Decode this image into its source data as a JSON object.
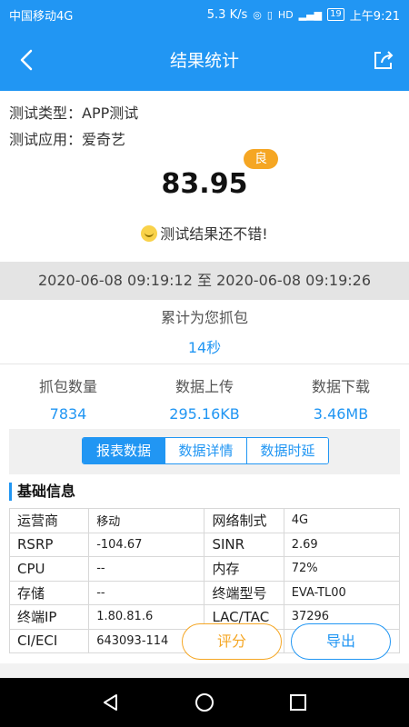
{
  "status_bar": {
    "carrier": "中国移动4G",
    "speed": "5.3 K/s",
    "battery": "19",
    "time": "上午9:21"
  },
  "header": {
    "title": "结果统计",
    "back_icon": "back-arrow-icon",
    "share_icon": "share-icon"
  },
  "info": {
    "type_label": "测试类型：APP测试",
    "app_label": "测试应用：爱奇艺"
  },
  "score": {
    "value": "83.95",
    "grade": "良",
    "remark": "测试结果还不错!"
  },
  "time_range": "2020-06-08 09:19:12  至  2020-06-08 09:19:26",
  "cumulative": {
    "label": "累计为您抓包",
    "value": "14秒"
  },
  "stats": [
    {
      "label": "抓包数量",
      "value": "7834"
    },
    {
      "label": "数据上传",
      "value": "295.16KB"
    },
    {
      "label": "数据下载",
      "value": "3.46MB"
    }
  ],
  "tabs": [
    {
      "label": "报表数据",
      "active": true
    },
    {
      "label": "数据详情",
      "active": false
    },
    {
      "label": "数据时延",
      "active": false
    }
  ],
  "basic_info": {
    "title": "基础信息",
    "rows": [
      {
        "k1": "运营商",
        "v1": "移动",
        "k2": "网络制式",
        "v2": "4G"
      },
      {
        "k1": "RSRP",
        "v1": "-104.67",
        "k2": "SINR",
        "v2": "2.69"
      },
      {
        "k1": "CPU",
        "v1": "--",
        "k2": "内存",
        "v2": "72%"
      },
      {
        "k1": "存储",
        "v1": "--",
        "k2": "终端型号",
        "v2": "EVA-TL00"
      },
      {
        "k1": "终端IP",
        "v1": "1.80.81.6",
        "k2": "LAC/TAC",
        "v2": "37296"
      },
      {
        "k1": "CI/ECI",
        "v1": "643093-114",
        "k2": "",
        "v2": ""
      }
    ]
  },
  "buttons": {
    "rate": "评分",
    "export": "导出"
  },
  "colors": {
    "primary": "#2196f3",
    "grade": "#f5a623"
  }
}
